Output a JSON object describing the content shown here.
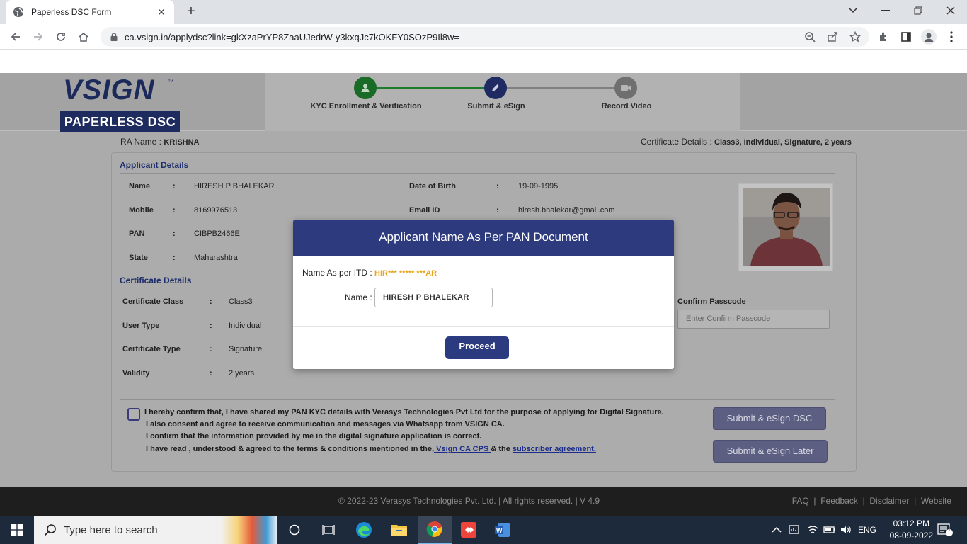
{
  "browser": {
    "tab_title": "Paperless DSC Form",
    "url": "ca.vsign.in/applydsc?link=gkXzaPrYP8ZaaUJedrW-y3kxqJc7kOKFY0SOzP9Il8w="
  },
  "brand": {
    "logo_text": "VSIGN",
    "logo_tm": "™",
    "tagline": "PAPERLESS DSC",
    "primary_color": "#1e2b5e"
  },
  "steps": [
    {
      "label": "KYC Enrollment & Verification",
      "status": "done",
      "icon": "user-icon"
    },
    {
      "label": "Submit & eSign",
      "status": "active",
      "icon": "pen-icon"
    },
    {
      "label": "Record Video",
      "status": "pending",
      "icon": "video-icon"
    }
  ],
  "ra": {
    "label": "RA Name :",
    "value": "KRISHNA"
  },
  "certificate_details": {
    "label": "Certificate Details :",
    "value": "Class3, Individual, Signature, 2 years"
  },
  "applicant": {
    "section_title": "Applicant Details",
    "name_label": "Name",
    "name": "HIRESH P BHALEKAR",
    "mobile_label": "Mobile",
    "mobile": "8169976513",
    "pan_label": "PAN",
    "pan": "CIBPB2466E",
    "state_label": "State",
    "state": "Maharashtra",
    "dob_label": "Date of Birth",
    "dob": "19-09-1995",
    "email_label": "Email ID",
    "email": "hiresh.bhalekar@gmail.com",
    "colon": ":"
  },
  "certificate": {
    "section_title": "Certificate Details",
    "class_label": "Certificate Class",
    "class": "Class3",
    "user_type_label": "User Type",
    "user_type": "Individual",
    "type_label": "Certificate Type",
    "type": "Signature",
    "validity_label": "Validity",
    "validity": "2 years",
    "confirm_label": "Confirm Passcode",
    "confirm_placeholder": "Enter Confirm Passcode"
  },
  "consent": {
    "line1": "I hereby confirm that, I have shared my PAN KYC details with Verasys Technologies Pvt Ltd for the purpose of applying for Digital Signature.",
    "line2": "I also consent and agree to receive communication and messages via Whatsapp from VSIGN CA.",
    "line3": "I confirm that the information provided by me in the digital signature application is correct.",
    "line4_pre": "I have read , understood & agreed to the terms & conditions mentioned in the,",
    "link1": " Vsign CA CPS ",
    "mid": "& the ",
    "link2": "subscriber agreement."
  },
  "actions": {
    "submit_esign": "Submit & eSign DSC",
    "submit_later": "Submit & eSign Later"
  },
  "footer": {
    "copyright": "© 2022-23  Verasys Technologies Pvt. Ltd. | All rights reserved. | V 4.9",
    "links": [
      "FAQ",
      "Feedback",
      "Disclaimer",
      "Website"
    ],
    "sep": "|"
  },
  "modal": {
    "title": "Applicant Name As Per PAN Document",
    "itd_label": "Name As per ITD :",
    "itd_value": "HIR*** ***** ***AR",
    "name_label": "Name :",
    "name_value": "HIRESH P BHALEKAR",
    "proceed": "Proceed"
  },
  "taskbar": {
    "search_placeholder": "Type here to search",
    "lang": "ENG",
    "time": "03:12 PM",
    "date": "08-09-2022",
    "notification_count": "1"
  }
}
